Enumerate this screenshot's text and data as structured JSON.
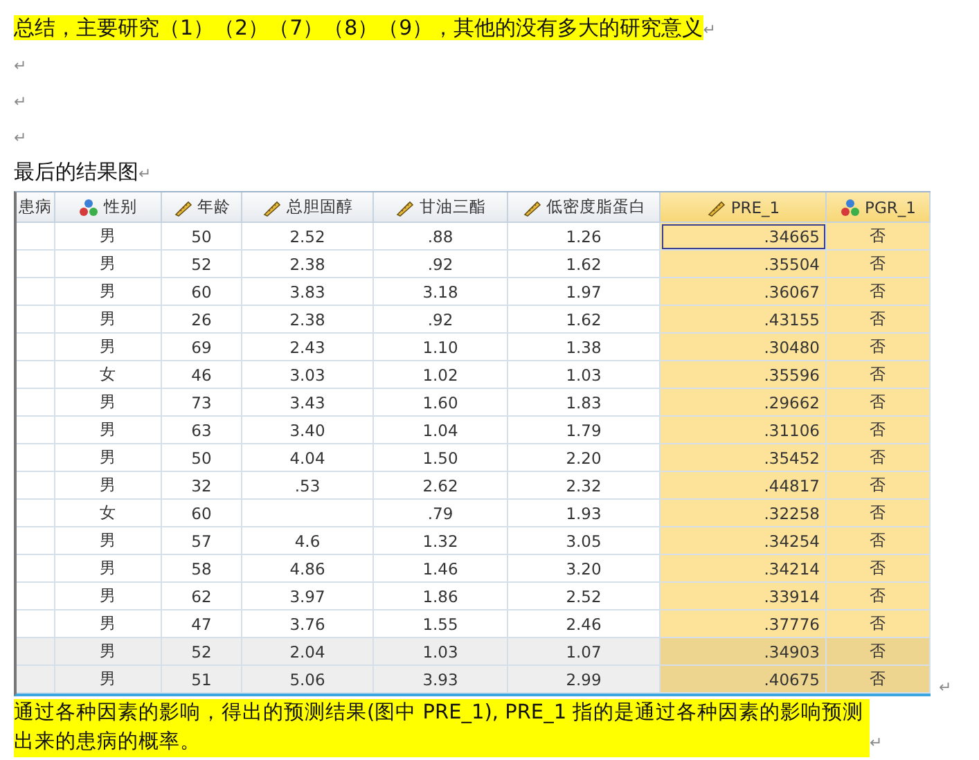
{
  "paragraphs_top": [
    {
      "text": "总结，主要研究（1）（2）（7）（8）（9），其他的没有多大的研究意义",
      "highlighted": true,
      "mark": "↵"
    },
    {
      "mark": "↵"
    },
    {
      "mark": "↵"
    },
    {
      "mark": "↵"
    },
    {
      "text": "最后的结果图",
      "highlighted": false,
      "mark": "↵"
    }
  ],
  "table": {
    "columns": [
      {
        "label": "患病",
        "kind": "none",
        "highlighted": false,
        "selected": false
      },
      {
        "label": "性别",
        "kind": "nominal",
        "highlighted": false,
        "selected": false
      },
      {
        "label": "年龄",
        "kind": "scale",
        "highlighted": false,
        "selected": false
      },
      {
        "label": "总胆固醇",
        "kind": "scale",
        "highlighted": false,
        "selected": false
      },
      {
        "label": "甘油三酯",
        "kind": "scale",
        "highlighted": false,
        "selected": false
      },
      {
        "label": "低密度脂蛋白",
        "kind": "scale",
        "highlighted": false,
        "selected": false
      },
      {
        "label": "PRE_1",
        "kind": "scale",
        "highlighted": true,
        "selected": true
      },
      {
        "label": "PGR_1",
        "kind": "nominal",
        "highlighted": true,
        "selected": false
      }
    ],
    "rows": [
      {
        "selected": true,
        "cells": [
          null,
          "男",
          "50",
          "2.52",
          ".88",
          "1.26",
          ".34665",
          "否"
        ]
      },
      {
        "selected": false,
        "cells": [
          null,
          "男",
          "52",
          "2.38",
          ".92",
          "1.62",
          ".35504",
          "否"
        ]
      },
      {
        "selected": false,
        "cells": [
          null,
          "男",
          "60",
          "3.83",
          "3.18",
          "1.97",
          ".36067",
          "否"
        ]
      },
      {
        "selected": false,
        "cells": [
          null,
          "男",
          "26",
          "2.38",
          ".92",
          "1.62",
          ".43155",
          "否"
        ]
      },
      {
        "selected": false,
        "cells": [
          null,
          "男",
          "69",
          "2.43",
          "1.10",
          "1.38",
          ".30480",
          "否"
        ]
      },
      {
        "selected": false,
        "cells": [
          null,
          "女",
          "46",
          "3.03",
          "1.02",
          "1.03",
          ".35596",
          "否"
        ]
      },
      {
        "selected": false,
        "cells": [
          null,
          "男",
          "73",
          "3.43",
          "1.60",
          "1.83",
          ".29662",
          "否"
        ]
      },
      {
        "selected": false,
        "cells": [
          null,
          "男",
          "63",
          "3.40",
          "1.04",
          "1.79",
          ".31106",
          "否"
        ]
      },
      {
        "selected": false,
        "cells": [
          null,
          "男",
          "50",
          "4.04",
          "1.50",
          "2.20",
          ".35452",
          "否"
        ]
      },
      {
        "selected": false,
        "cells": [
          null,
          "男",
          "32",
          ".53",
          "2.62",
          "2.32",
          ".44817",
          "否"
        ]
      },
      {
        "selected": false,
        "cells": [
          null,
          "女",
          "60",
          null,
          ".79",
          "1.93",
          ".32258",
          "否"
        ]
      },
      {
        "selected": false,
        "cells": [
          null,
          "男",
          "57",
          "4.6",
          "1.32",
          "3.05",
          ".34254",
          "否"
        ]
      },
      {
        "selected": false,
        "cells": [
          null,
          "男",
          "58",
          "4.86",
          "1.46",
          "3.20",
          ".34214",
          "否"
        ]
      },
      {
        "selected": false,
        "cells": [
          null,
          "男",
          "62",
          "3.97",
          "1.86",
          "2.52",
          ".33914",
          "否"
        ]
      },
      {
        "selected": false,
        "cells": [
          null,
          "男",
          "47",
          "3.76",
          "1.55",
          "2.46",
          ".37776",
          "否"
        ]
      },
      {
        "selected": false,
        "cells": [
          null,
          "男",
          "52",
          "2.04",
          "1.03",
          "1.07",
          ".34903",
          "否"
        ]
      },
      {
        "selected": false,
        "cells": [
          null,
          "男",
          "51",
          "5.06",
          "3.93",
          "2.99",
          ".40675",
          "否"
        ]
      }
    ],
    "end_mark": "↵"
  },
  "paragraphs_bottom": [
    {
      "text": "通过各种因素的影响，得出的预测结果(图中 PRE_1), PRE_1 指的是通过各种因素的影响预测出来的患病的概率。",
      "highlighted": true,
      "mark": "↵"
    }
  ]
}
